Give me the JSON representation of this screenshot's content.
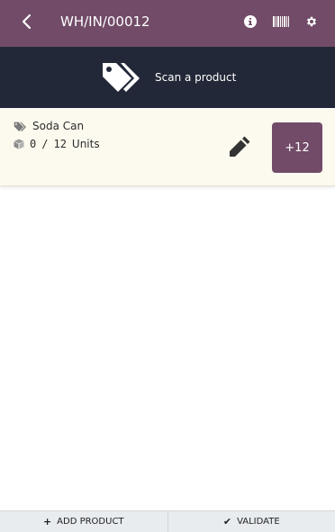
{
  "header": {
    "title": "WH/IN/00012",
    "back_icon": "chevron-left-icon",
    "icons": [
      "info-icon",
      "barcode-icon",
      "gear-icon"
    ]
  },
  "scan": {
    "icon": "tags-icon",
    "text": "Scan a product"
  },
  "line": {
    "product_icon": "tags-icon",
    "product_name": "Soda Can",
    "qty_icon": "cube-icon",
    "qty_done": "0",
    "qty_sep": "/",
    "qty_total": "12",
    "uom": "Units",
    "edit_icon": "pencil-icon",
    "increment_label": "+12"
  },
  "footer": {
    "add_product_icon": "+",
    "add_product_label": "ADD PRODUCT",
    "validate_icon": "✔",
    "validate_label": "VALIDATE"
  },
  "colors": {
    "brand": "#714b67",
    "scan_bar": "#232838",
    "line_bg": "#fcf9ee"
  }
}
